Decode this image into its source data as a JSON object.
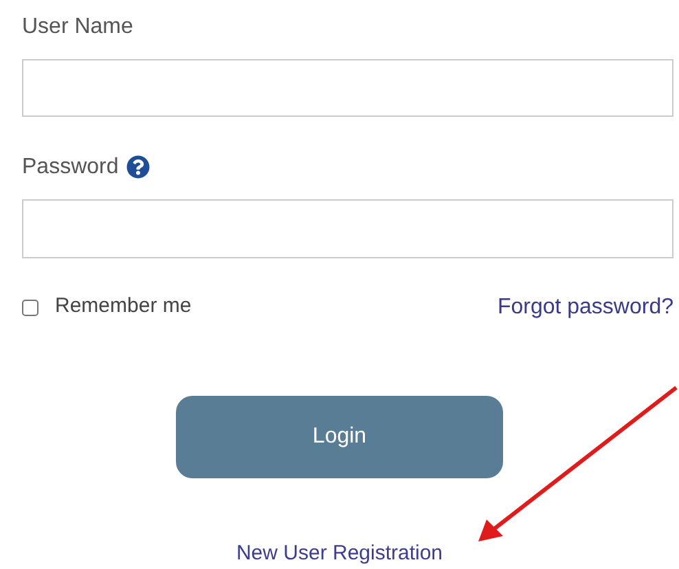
{
  "username": {
    "label": "User Name"
  },
  "password": {
    "label": "Password"
  },
  "remember": {
    "label": "Remember me",
    "checked": false
  },
  "forgot_link": "Forgot password?",
  "login_button": "Login",
  "register_link": "New User Registration"
}
